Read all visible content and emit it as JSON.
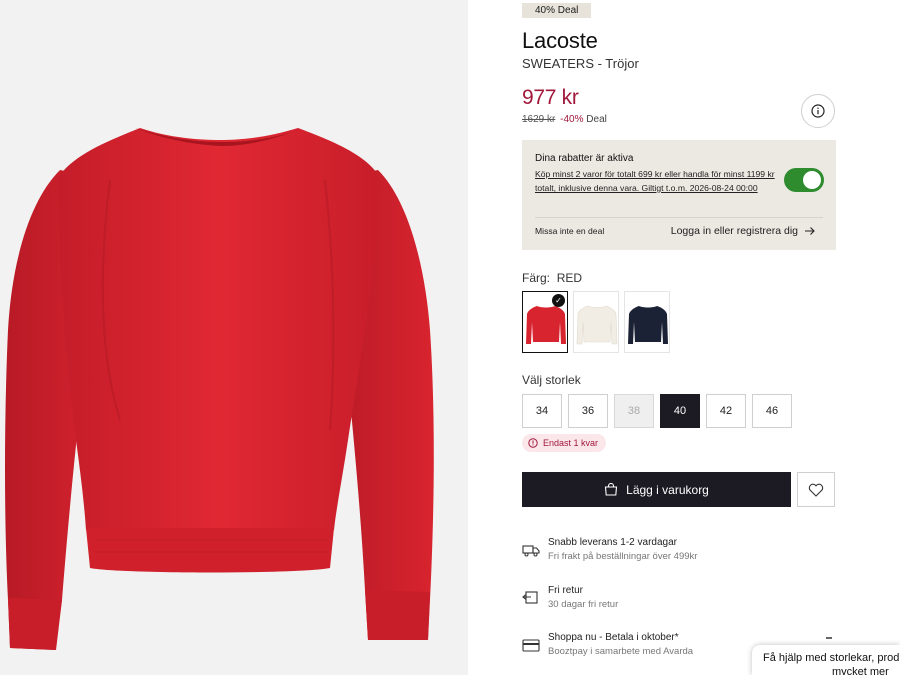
{
  "product": {
    "deal_badge": "40% Deal",
    "brand": "Lacoste",
    "category": "SWEATERS - Tröjor",
    "price": "977 kr",
    "old_price": "1629 kr",
    "discount": "-40%",
    "discount_suffix": "Deal"
  },
  "promo": {
    "title": "Dina rabatter är aktiva",
    "text": "Köp minst 2 varor för totalt 699 kr eller handla för minst 1199 kr totalt, inklusive denna vara. Giltigt t.o.m. 2026-08-24 00:00",
    "toggle_on": true,
    "missed": "Missa inte en deal",
    "login": "Logga in eller registrera dig"
  },
  "color": {
    "label": "Färg:",
    "value": "RED",
    "swatches": [
      {
        "name": "red",
        "color": "#d8242f",
        "selected": true
      },
      {
        "name": "white",
        "color": "#f4f1ea",
        "selected": false
      },
      {
        "name": "navy",
        "color": "#1c2235",
        "selected": false
      }
    ]
  },
  "size": {
    "label": "Välj storlek",
    "options": [
      "34",
      "36",
      "38",
      "40",
      "42",
      "46"
    ],
    "disabled": [
      "38"
    ],
    "selected": "40"
  },
  "stock": {
    "text": "Endast 1 kvar"
  },
  "cart": {
    "add_label": "Lägg i varukorg"
  },
  "features": [
    {
      "icon": "truck-icon",
      "title": "Snabb leverans 1-2 vardagar",
      "subtitle": "Fri frakt på beställningar över 499kr"
    },
    {
      "icon": "return-icon",
      "title": "Fri retur",
      "subtitle": "30 dagar fri retur"
    },
    {
      "icon": "card-icon",
      "title": "Shoppa nu - Betala i oktober*",
      "subtitle": "Boozt­pay i samarbete med Avarda"
    }
  ],
  "help": {
    "line1": "Få hjälp med storlekar, prod",
    "line2": "mycket mer"
  },
  "colors": {
    "price_red": "#a1183b",
    "primary_dark": "#1c1b24",
    "toggle_green": "#2e8b2e",
    "promo_bg": "#ece8e2"
  }
}
